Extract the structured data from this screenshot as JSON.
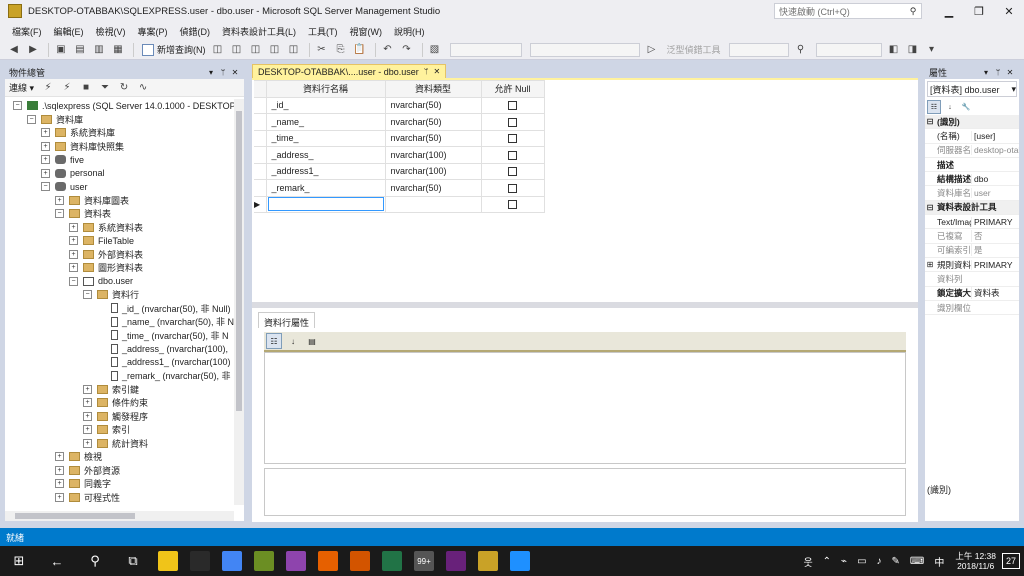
{
  "window": {
    "title": "DESKTOP-OTABBAK\\SQLEXPRESS.user - dbo.user - Microsoft SQL Server Management Studio",
    "quick_launch_placeholder": "快速啟動 (Ctrl+Q)"
  },
  "menu": [
    "檔案(F)",
    "編輯(E)",
    "檢視(V)",
    "專案(P)",
    "偵錯(D)",
    "資料表設計工具(L)",
    "工具(T)",
    "視窗(W)",
    "說明(H)"
  ],
  "toolbar": {
    "new_query": "新增查詢(N)",
    "generic_debugger": "泛型偵錯工具"
  },
  "object_explorer": {
    "title": "物件總管",
    "connect": "連線",
    "tree": [
      {
        "label": ".\\sqlexpress (SQL Server 14.0.1000 - DESKTOP",
        "indent": 0,
        "expander": "−",
        "icon": "server"
      },
      {
        "label": "資料庫",
        "indent": 1,
        "expander": "−",
        "icon": "folder"
      },
      {
        "label": "系統資料庫",
        "indent": 2,
        "expander": "+",
        "icon": "folder"
      },
      {
        "label": "資料庫快照集",
        "indent": 2,
        "expander": "+",
        "icon": "folder"
      },
      {
        "label": "five",
        "indent": 2,
        "expander": "+",
        "icon": "db"
      },
      {
        "label": "personal",
        "indent": 2,
        "expander": "+",
        "icon": "db"
      },
      {
        "label": "user",
        "indent": 2,
        "expander": "−",
        "icon": "db"
      },
      {
        "label": "資料庫圖表",
        "indent": 3,
        "expander": "+",
        "icon": "folder"
      },
      {
        "label": "資料表",
        "indent": 3,
        "expander": "−",
        "icon": "folder"
      },
      {
        "label": "系統資料表",
        "indent": 4,
        "expander": "+",
        "icon": "folder"
      },
      {
        "label": "FileTable",
        "indent": 4,
        "expander": "+",
        "icon": "folder"
      },
      {
        "label": "外部資料表",
        "indent": 4,
        "expander": "+",
        "icon": "folder"
      },
      {
        "label": "圖形資料表",
        "indent": 4,
        "expander": "+",
        "icon": "folder"
      },
      {
        "label": "dbo.user",
        "indent": 4,
        "expander": "−",
        "icon": "table"
      },
      {
        "label": "資料行",
        "indent": 5,
        "expander": "−",
        "icon": "folder"
      },
      {
        "label": "_id_ (nvarchar(50), 非 Null)",
        "indent": 6,
        "expander": "",
        "icon": "col"
      },
      {
        "label": "_name_ (nvarchar(50), 非 N",
        "indent": 6,
        "expander": "",
        "icon": "col"
      },
      {
        "label": "_time_ (nvarchar(50), 非 N",
        "indent": 6,
        "expander": "",
        "icon": "col"
      },
      {
        "label": "_address_ (nvarchar(100),",
        "indent": 6,
        "expander": "",
        "icon": "col"
      },
      {
        "label": "_address1_ (nvarchar(100)",
        "indent": 6,
        "expander": "",
        "icon": "col"
      },
      {
        "label": "_remark_ (nvarchar(50), 非",
        "indent": 6,
        "expander": "",
        "icon": "col"
      },
      {
        "label": "索引鍵",
        "indent": 5,
        "expander": "+",
        "icon": "folder"
      },
      {
        "label": "條件約束",
        "indent": 5,
        "expander": "+",
        "icon": "folder"
      },
      {
        "label": "觸發程序",
        "indent": 5,
        "expander": "+",
        "icon": "folder"
      },
      {
        "label": "索引",
        "indent": 5,
        "expander": "+",
        "icon": "folder"
      },
      {
        "label": "統計資料",
        "indent": 5,
        "expander": "+",
        "icon": "folder"
      },
      {
        "label": "檢視",
        "indent": 3,
        "expander": "+",
        "icon": "folder"
      },
      {
        "label": "外部資源",
        "indent": 3,
        "expander": "+",
        "icon": "folder"
      },
      {
        "label": "同義字",
        "indent": 3,
        "expander": "+",
        "icon": "folder"
      },
      {
        "label": "可程式性",
        "indent": 3,
        "expander": "+",
        "icon": "folder"
      }
    ]
  },
  "document_tab": {
    "label": "DESKTOP-OTABBAK\\....user - dbo.user"
  },
  "designer": {
    "headers": {
      "name": "資料行名稱",
      "type": "資料類型",
      "null": "允許 Null"
    },
    "rows": [
      {
        "name": "_id_",
        "type": "nvarchar(50)",
        "null": false
      },
      {
        "name": "_name_",
        "type": "nvarchar(50)",
        "null": false
      },
      {
        "name": "_time_",
        "type": "nvarchar(50)",
        "null": false
      },
      {
        "name": "_address_",
        "type": "nvarchar(100)",
        "null": false
      },
      {
        "name": "_address1_",
        "type": "nvarchar(100)",
        "null": false
      },
      {
        "name": "_remark_",
        "type": "nvarchar(50)",
        "null": false
      }
    ],
    "new_row_value": "",
    "new_row_marker": "▶"
  },
  "column_properties": {
    "tab": "資料行屬性"
  },
  "properties": {
    "title": "屬性",
    "combo": "[資料表] dbo.user",
    "rows": [
      {
        "kind": "cat",
        "exp": "⊟",
        "name": "(識別)",
        "val": ""
      },
      {
        "kind": "prop",
        "exp": "",
        "name": "(名稱)",
        "val": "[user]"
      },
      {
        "kind": "dim",
        "exp": "",
        "name": "伺服器名稱",
        "val": "desktop-otabbak"
      },
      {
        "kind": "bold",
        "exp": "",
        "name": "描述",
        "val": ""
      },
      {
        "kind": "bold",
        "exp": "",
        "name": "結構描述",
        "val": "dbo"
      },
      {
        "kind": "dim",
        "exp": "",
        "name": "資料庫名稱",
        "val": "user"
      },
      {
        "kind": "cat",
        "exp": "⊟",
        "name": "資料表設計工具",
        "val": ""
      },
      {
        "kind": "prop",
        "exp": "",
        "name": "Text/Image",
        "val": "PRIMARY"
      },
      {
        "kind": "dim",
        "exp": "",
        "name": "已複寫",
        "val": "否"
      },
      {
        "kind": "dim",
        "exp": "",
        "name": "可編索引",
        "val": "是"
      },
      {
        "kind": "prop",
        "exp": "⊞",
        "name": "規則資料",
        "val": "PRIMARY"
      },
      {
        "kind": "dim",
        "exp": "",
        "name": "資料列",
        "val": ""
      },
      {
        "kind": "bold",
        "exp": "",
        "name": "鎖定擴大",
        "val": "資料表"
      },
      {
        "kind": "dim",
        "exp": "",
        "name": "識別欄位",
        "val": ""
      }
    ],
    "footer": "(識別)"
  },
  "statusbar": {
    "text": "就緒"
  },
  "taskbar": {
    "time": "上午 12:38",
    "date": "2018/11/6",
    "notification_count": "27",
    "lang": "中",
    "badge": "99+",
    "apps": [
      "#f0c419",
      "#2a2a2a",
      "#4285f4",
      "#6b8e23",
      "#8e44ad",
      "#e66000",
      "#d35400",
      "#217346",
      "#555555",
      "#68217a",
      "#c9a227",
      "#1e90ff"
    ]
  }
}
